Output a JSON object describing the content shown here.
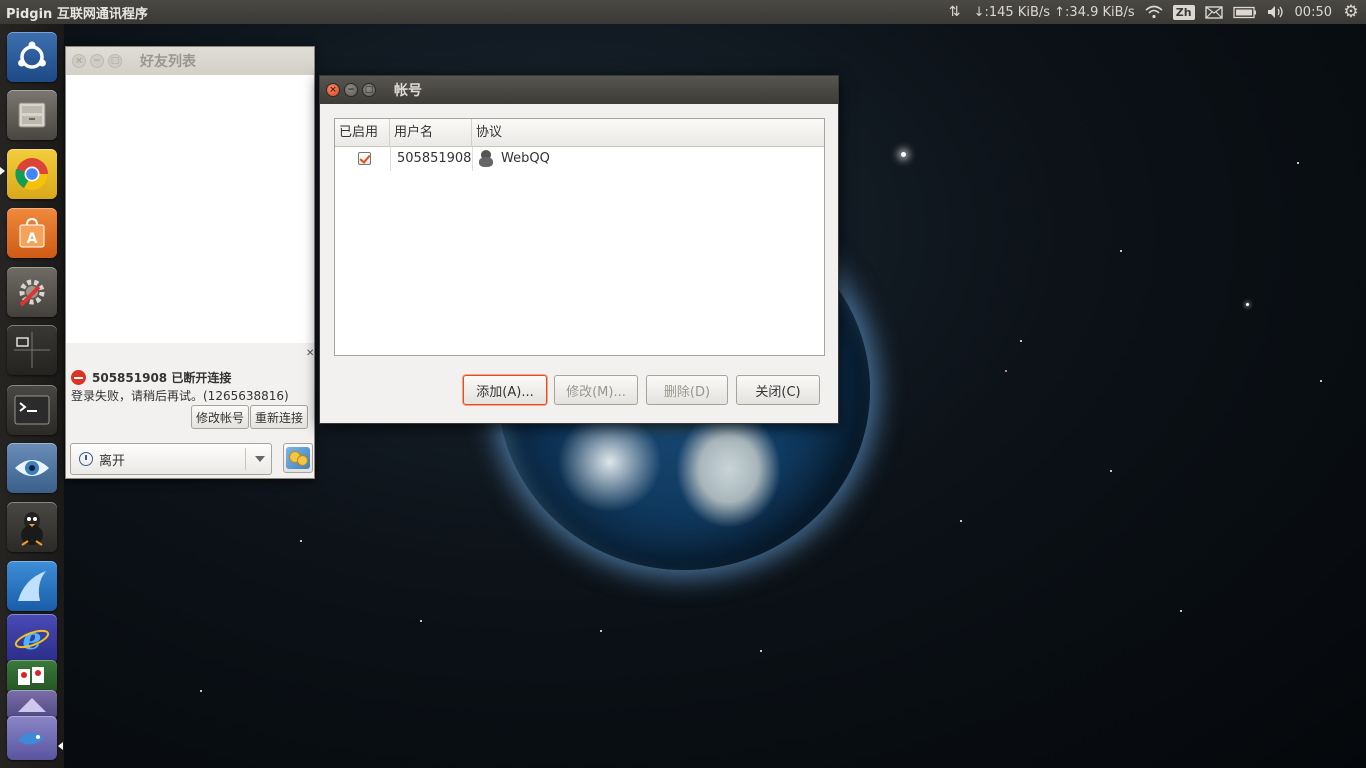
{
  "top_panel": {
    "app_title": "Pidgin 互联网通讯程序",
    "network_speed": "↓:145 KiB/s ↑:34.9 KiB/s",
    "input_method": "Zh",
    "time": "00:50",
    "icons": [
      "transfer-arrows-icon",
      "wifi-icon",
      "mail-icon",
      "battery-icon",
      "volume-icon",
      "gear-icon"
    ]
  },
  "launcher": {
    "items": [
      "ubuntu-dash-icon",
      "file-manager-icon",
      "chrome-icon",
      "software-center-icon",
      "system-settings-icon",
      "workspace-switcher-icon",
      "terminal-icon",
      "eye-app-icon",
      "pidgin-icon",
      "shark-app-icon",
      "ie-icon",
      "card-game-icon",
      "app-icon",
      "bluefish-icon"
    ]
  },
  "buddy_window": {
    "title": "好友列表",
    "error_title": "505851908 已断开连接",
    "error_detail": "登录失败，请稍后再试。(1265638816)",
    "modify_account_label": "修改帐号",
    "reconnect_label": "重新连接",
    "status_value": "离开"
  },
  "accounts_dialog": {
    "title": "帐号",
    "columns": [
      "已启用",
      "用户名",
      "协议"
    ],
    "rows": [
      {
        "enabled": true,
        "username": "505851908",
        "protocol": "WebQQ"
      }
    ],
    "buttons": {
      "add": "添加(A)...",
      "modify": "修改(M)...",
      "delete": "删除(D)",
      "close": "关闭(C)"
    }
  },
  "colors": {
    "accent_orange": "#e0501d",
    "panel_dark": "#3c3b37",
    "window_bg": "#f2f1f0"
  }
}
